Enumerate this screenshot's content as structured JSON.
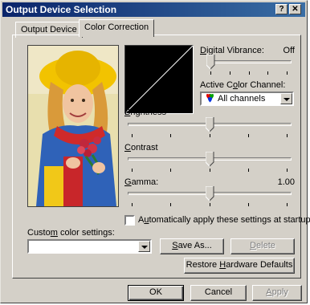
{
  "window": {
    "title": "Output Device Selection",
    "help_glyph": "?",
    "close_glyph": "✕"
  },
  "tabs": [
    {
      "label": "Output Device",
      "active": false
    },
    {
      "label": "Color Correction",
      "active": true
    }
  ],
  "digital_vibrance": {
    "label": "Digital Vibrance:",
    "value_text": "Off",
    "level": 0.0
  },
  "active_color_channel": {
    "label": "Active Color Channel:",
    "selected": "All channels",
    "icon": "rgb-hearts-icon"
  },
  "brightness": {
    "label": "Brightness",
    "level": 0.5
  },
  "contrast": {
    "label": "Contrast",
    "level": 0.5
  },
  "gamma": {
    "label": "Gamma:",
    "value_text": "1.00",
    "level": 0.5
  },
  "auto_apply": {
    "label": "Automatically apply these settings at startup",
    "checked": false
  },
  "custom_settings": {
    "label": "Custom color settings:",
    "value": ""
  },
  "buttons": {
    "save_as": "Save As...",
    "delete": "Delete",
    "restore": "Restore Hardware Defaults",
    "ok": "OK",
    "cancel": "Cancel",
    "apply": "Apply"
  },
  "colors": {
    "titlebar_start": "#0a246a",
    "titlebar_end": "#3a6ea5",
    "face": "#d4d0c8"
  }
}
